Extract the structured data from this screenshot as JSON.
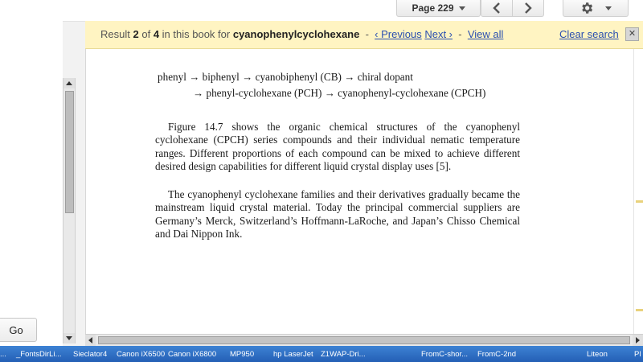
{
  "toolbar": {
    "page_label": "Page 229"
  },
  "left_panel": {
    "go_label": "Go"
  },
  "search_bar": {
    "result_prefix": "Result",
    "result_index": "2",
    "result_of": "of",
    "result_total": "4",
    "in_book_text": "in this book for",
    "query": "cyanophenylcyclohexane",
    "sep1": "-",
    "previous_label": "‹ Previous",
    "next_label": "Next ›",
    "sep2": "-",
    "view_all_label": "View all",
    "clear_label": "Clear search",
    "close_glyph": "✕"
  },
  "page": {
    "chain_line1": "phenyl → biphenyl → cyanobiphenyl (CB) → chiral dopant",
    "chain_line2": "→ phenyl-cyclohexane (PCH) → cyanophenyl-cyclohexane (CPCH)",
    "paragraph1": "Figure 14.7 shows the organic chemical structures of the cyanophenyl cyclohexane (CPCH) series compounds and their individual nematic temperature ranges. Different proportions of each compound can be mixed to achieve different desired design capabilities for different liquid crystal display uses [5].",
    "paragraph2": "The cyanophenyl cyclohexane families and their derivatives gradually became the mainstream liquid crystal material. Today the principal commercial suppliers are Germany’s Merck, Switzerland’s Hoffmann-LaRoche, and Japan’s Chisso Chemical and Dai Nippon Ink."
  },
  "taskbar": {
    "items": [
      "...",
      "_FontsDirLi...",
      "Sieclator4",
      "Canon iX6500",
      "Canon iX6800",
      "MP950",
      "hp LaserJet",
      "Z1WAP-Dri...",
      "FromC-shor...",
      "FromC-2nd",
      "Liteon",
      "Pl"
    ]
  },
  "colors": {
    "search_bar_bg": "#fff4c2",
    "link": "#2a4fb0",
    "taskbar": "#2f6fc8"
  },
  "icons": {
    "page_dropdown": "chevron-down-icon",
    "prev": "chevron-left-icon",
    "next": "chevron-right-icon",
    "settings": "gear-icon",
    "close": "close-icon"
  }
}
